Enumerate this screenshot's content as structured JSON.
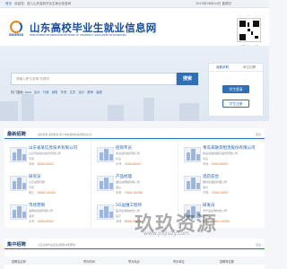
{
  "topbar": {
    "home_label": "首页",
    "welcome": "欢迎您，进入山东高校毕业生就业信息网",
    "date": "2024年08月04日 星期日"
  },
  "header": {
    "site_title": "山东高校毕业生就业信息网",
    "site_subtitle": "EMPLOYMENT INFORMATION NETWORK OF UNIVERSITY GRADUATES IN SHANDONG",
    "logo_text": "SDHRSS",
    "qr_caption": "扫码关注公众号"
  },
  "search": {
    "placeholder": "请输入职位名称/关键字",
    "button_label": "搜索",
    "hot_label": "热门搜索:",
    "hot_words": [
      "Java",
      "会计",
      "行政",
      "销售",
      "外贸",
      "文员",
      "设计",
      "教师",
      "客服"
    ]
  },
  "side_panel": {
    "tabs": [
      "我要求职",
      "单位招聘"
    ],
    "buttons": [
      "学生登录",
      "学生注册"
    ]
  },
  "sections": {
    "latest": {
      "title": "最新招聘",
      "desc": "最新招募 最新职位 用人单位发布的最新职位信息",
      "more": "更多"
    },
    "campus": {
      "title": "集中招聘",
      "desc": "山东高校毕业生就业网集中招聘会",
      "more": "更多"
    }
  },
  "jobs": [
    {
      "title": "山东省某信息技术有限公司",
      "company": "山东省某信息技术有限公司",
      "loc": "济南",
      "edu": "本科",
      "pay": "6000-9000"
    },
    {
      "title": "招商专员",
      "company": "青岛某科技有限公司",
      "loc": "青岛",
      "edu": "大专",
      "pay": "4500-6000"
    },
    {
      "title": "青岛某融资租赁股份有限公司",
      "company": "青岛某融资租赁股份有限公司",
      "loc": "青岛",
      "edu": "本科",
      "pay": "5000-8000"
    },
    {
      "title": "研究员",
      "company": "山东某研究院",
      "loc": "济南",
      "edu": "硕士",
      "pay": "8000-12000"
    },
    {
      "title": "产品经理",
      "company": "烟台某网络科技公司",
      "loc": "烟台",
      "edu": "本科",
      "pay": "7000-10000"
    },
    {
      "title": "酒店前台",
      "company": "潍坊某酒店管理公司",
      "loc": "潍坊",
      "edu": "不限",
      "pay": "3500-5000"
    },
    {
      "title": "市场营销",
      "company": "淄博某贸易有限公司",
      "loc": "淄博",
      "edu": "大专",
      "pay": "4000-6500"
    },
    {
      "title": "5G运维工程师",
      "company": "临沂某通信技术公司",
      "loc": "临沂",
      "edu": "本科",
      "pay": "6000-9000"
    },
    {
      "title": "研发员",
      "company": "济宁某生物科技公司",
      "loc": "济宁",
      "edu": "硕士",
      "pay": "7000-11000"
    }
  ],
  "table": {
    "headers": [
      "招聘会名称",
      "举办时间",
      "举办地点",
      "举办单位",
      "招聘单位数"
    ]
  },
  "watermark": {
    "main": "玖玖资源",
    "sub": "www.jiujiuzy.com"
  }
}
